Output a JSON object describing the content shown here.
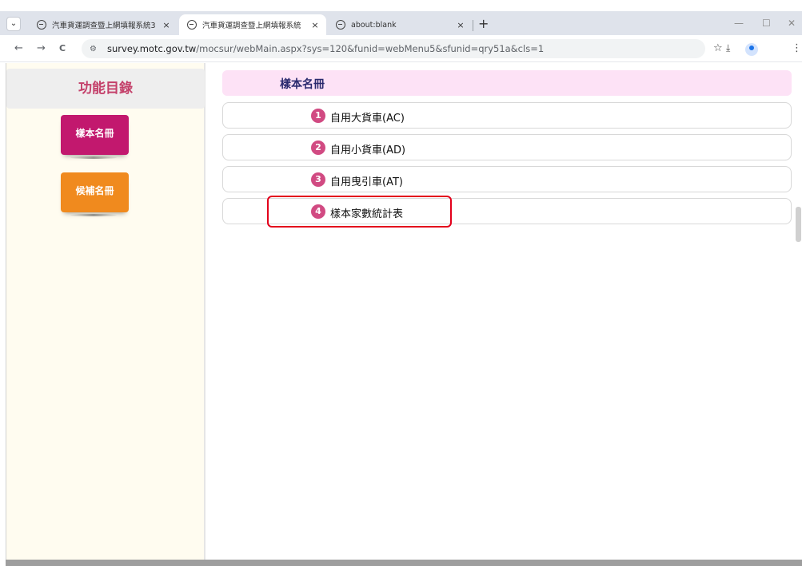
{
  "browser": {
    "tabs": [
      {
        "title": "汽車貨運調查暨上網填報系統3",
        "close": "×"
      },
      {
        "title": "汽車貨運調查暨上網填報系統",
        "close": "×"
      },
      {
        "title": "about:blank",
        "close": "×"
      }
    ],
    "tab_menu_icon": "chevron-down-icon",
    "new_tab": "+",
    "window_controls": {
      "minimize": "—",
      "maximize": "☐",
      "close": "✕"
    },
    "nav": {
      "back": "←",
      "forward": "→",
      "reload": "C"
    },
    "site_icon": "⚙",
    "url_host": "survey.motc.gov.tw",
    "url_path": "/mocsur/webMain.aspx?sys=120&funid=webMenu5&sfunid=qry51a&cls=1",
    "bookmark_icon": "☆",
    "download_icon": "⤓",
    "menu_icon": "⋮"
  },
  "sidebar": {
    "title": "功能目錄",
    "buttons": [
      {
        "label": "樣本名冊",
        "color": "#c2186e"
      },
      {
        "label": "候補名冊",
        "color": "#f08a1e"
      }
    ]
  },
  "content": {
    "header": "樣本名冊",
    "items": [
      {
        "num": "1",
        "label": "自用大貨車(AC)"
      },
      {
        "num": "2",
        "label": "自用小貨車(AD)"
      },
      {
        "num": "3",
        "label": "自用曳引車(AT)"
      },
      {
        "num": "4",
        "label": "樣本家數統計表"
      }
    ],
    "highlight_color": "#e3001b"
  }
}
